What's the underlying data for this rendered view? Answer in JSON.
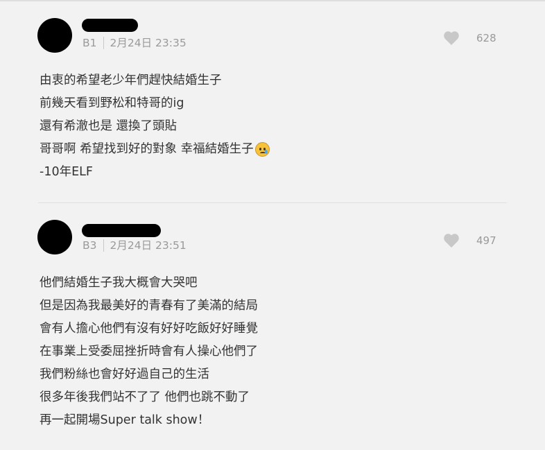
{
  "comments": [
    {
      "floor": "B1",
      "datetime": "2月24日 23:35",
      "like_count": "628",
      "lines": [
        "由衷的希望老少年們趕快結婚生子",
        "前幾天看到野松和特哥的ig",
        "還有希澈也是 還換了頭貼",
        "哥哥啊 希望找到好的對象 幸福結婚生子",
        "-10年ELF"
      ],
      "emoji": "crying-face-emoji"
    },
    {
      "floor": "B3",
      "datetime": "2月24日 23:51",
      "like_count": "497",
      "lines": [
        "他們結婚生子我大概會大哭吧",
        "但是因為我最美好的青春有了美滿的結局",
        "會有人擔心他們有沒有好好吃飯好好睡覺",
        "在事業上受委屈挫折時會有人操心他們了",
        "我們粉絲也會好好過自己的生活",
        "很多年後我們站不了了 他們也跳不動了",
        "再一起開場Super talk show！"
      ]
    }
  ],
  "icons": {
    "like": "heart-icon"
  },
  "colors": {
    "background": "#f2f2f2",
    "text": "#333333",
    "meta": "#9a9a9a",
    "heart": "#c8c8c8"
  }
}
